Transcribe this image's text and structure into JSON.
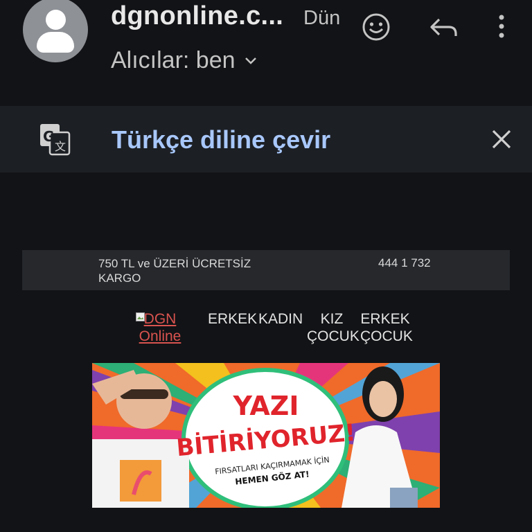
{
  "header": {
    "sender": "dgnonline.c...",
    "time": "Dün",
    "recipients_label": "Alıcılar: ben"
  },
  "icons": {
    "avatar": "person-avatar",
    "emoji": "add-reaction-icon",
    "reply": "reply-icon",
    "more": "more-vertical-icon",
    "translate": "google-translate-icon",
    "close": "close-icon",
    "chevron": "chevron-down-icon"
  },
  "translate_bar": {
    "text": "Türkçe diline çevir"
  },
  "email": {
    "promo_text": "750 TL ve ÜZERİ ÜCRETSİZ KARGO",
    "phone": "444 1 732",
    "logo_alt": "DGN Online",
    "nav": [
      "ERKEK",
      "KADIN",
      "KIZ ÇOCUK",
      "ERKEK ÇOCUK"
    ],
    "banner": {
      "line1": "YAZI",
      "line2": "BİTİRİYORUZ!",
      "sub1": "FIRSATLARI KAÇIRMAMAK İÇİN",
      "sub2": "HEMEN GÖZ AT!"
    }
  },
  "colors": {
    "background": "#121316",
    "translate_bar": "#1c1f24",
    "translate_text": "#a8c7fa",
    "banner_red": "#e0242c",
    "link_red": "#d9534f"
  }
}
